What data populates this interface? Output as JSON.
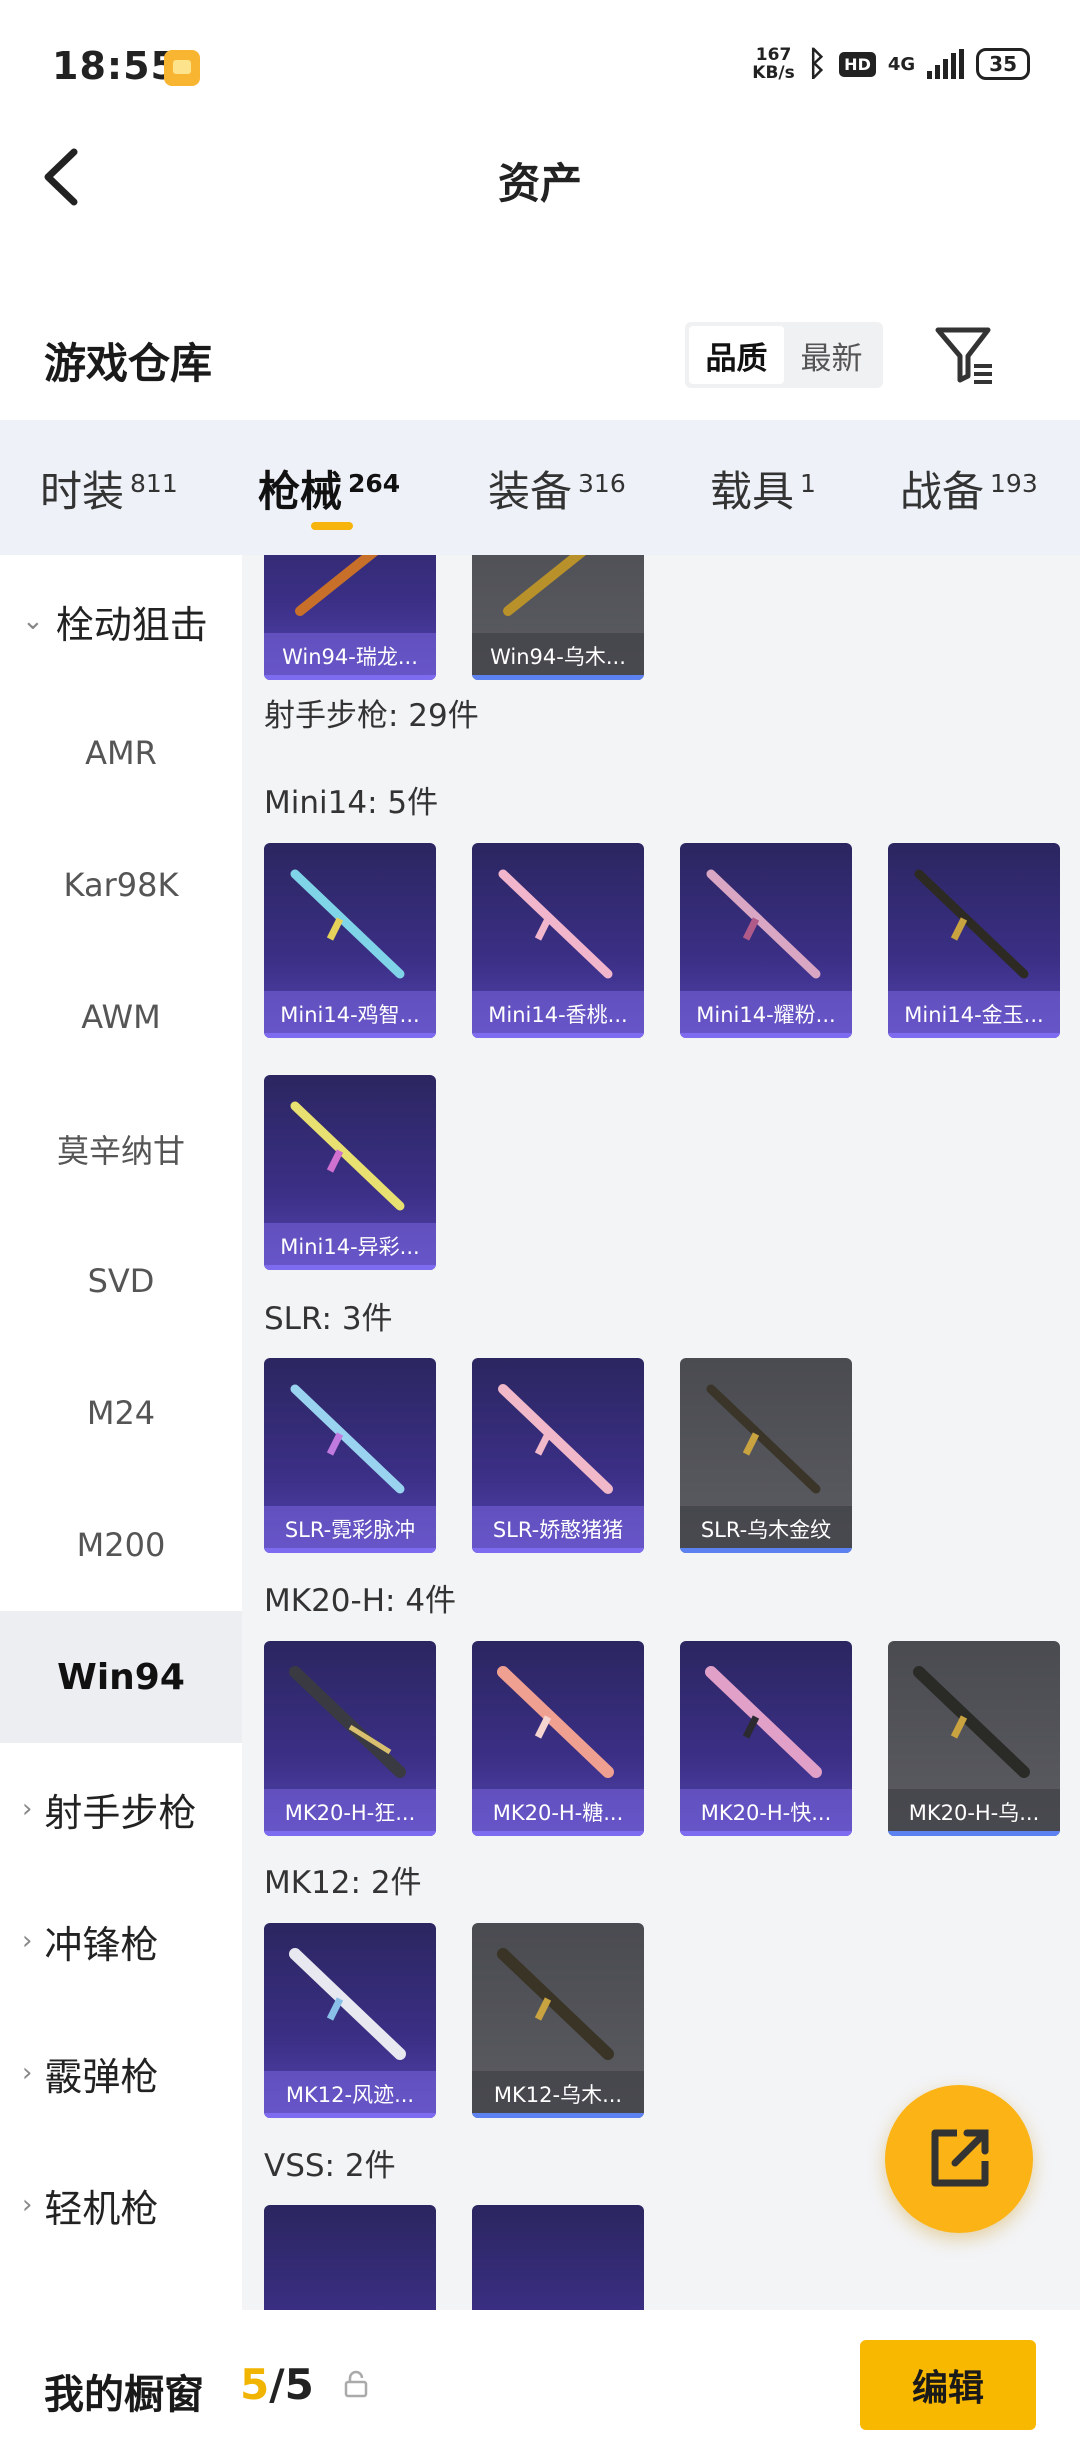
{
  "status": {
    "time": "18:55",
    "net_speed": "167",
    "net_unit": "KB/s",
    "hd": "HD",
    "signal": "4G",
    "battery": "35"
  },
  "header": {
    "title": "资产"
  },
  "warehouse": {
    "title": "游戏仓库",
    "sort": [
      "品质",
      "最新"
    ]
  },
  "tabs": [
    {
      "label": "时装",
      "count": "811"
    },
    {
      "label": "枪械",
      "count": "264"
    },
    {
      "label": "装备",
      "count": "316"
    },
    {
      "label": "载具",
      "count": "1"
    },
    {
      "label": "战备",
      "count": "193"
    }
  ],
  "sidebar": {
    "group_expanded": "栓动狙击",
    "items": [
      "AMR",
      "Kar98K",
      "AWM",
      "莫辛纳甘",
      "SVD",
      "M24",
      "M200",
      "Win94"
    ],
    "groups": [
      "射手步枪",
      "冲锋枪",
      "霰弹枪",
      "轻机枪"
    ]
  },
  "sections": {
    "top_cards": [
      "Win94-瑞龙...",
      "Win94-乌木..."
    ],
    "dmr_total": "射手步枪: 29件",
    "mini14": {
      "label": "Mini14: 5件",
      "cards": [
        "Mini14-鸡智...",
        "Mini14-香桃...",
        "Mini14-耀粉...",
        "Mini14-金玉...",
        "Mini14-异彩..."
      ]
    },
    "slr": {
      "label": "SLR: 3件",
      "cards": [
        "SLR-霓彩脉冲",
        "SLR-娇憨猪猪",
        "SLR-乌木金纹"
      ]
    },
    "mk20": {
      "label": "MK20-H: 4件",
      "cards": [
        "MK20-H-狂...",
        "MK20-H-糖...",
        "MK20-H-快...",
        "MK20-H-乌..."
      ]
    },
    "mk12": {
      "label": "MK12: 2件",
      "cards": [
        "MK12-风迹...",
        "MK12-乌木..."
      ]
    },
    "vss": {
      "label": "VSS: 2件"
    }
  },
  "showcase": {
    "label": "我的橱窗",
    "current": "5",
    "sep_total": "/5",
    "edit": "编辑"
  },
  "colors": {
    "accent": "#f9b800",
    "purple_card": "#3b2f86",
    "gray_card": "#55565c"
  }
}
